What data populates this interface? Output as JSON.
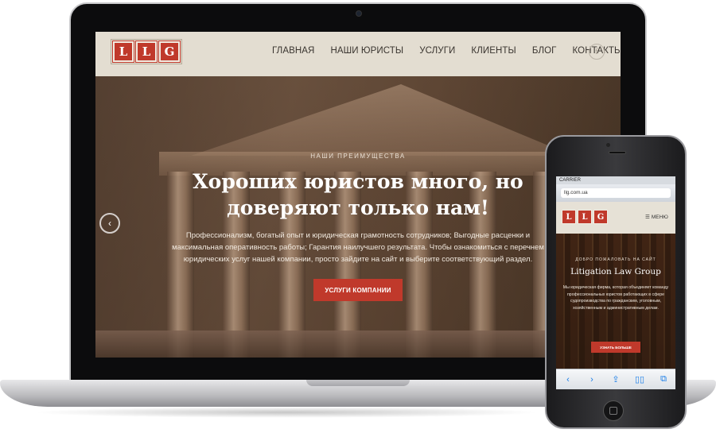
{
  "desktop": {
    "logo_letters": [
      "L",
      "L",
      "G"
    ],
    "nav": [
      "ГЛАВНАЯ",
      "НАШИ ЮРИСТЫ",
      "УСЛУГИ",
      "КЛИЕНТЫ",
      "БЛОГ",
      "КОНТАКТЫ"
    ],
    "facebook_glyph": "f",
    "hero": {
      "eyebrow": "НАШИ ПРЕИМУЩЕСТВА",
      "title": "Хороших юристов много, но доверяют только нам!",
      "text": "Профессионализм, богатый опыт и юридическая грамотность сотрудников; Выгодные расценки и максимальная оперативность работы; Гарантия наилучшего результата. Чтобы ознакомиться с перечнем юридических услуг нашей компании, просто зайдите на сайт и выберите соответствующий раздел.",
      "button": "УСЛУГИ КОМПАНИИ",
      "prev_glyph": "‹"
    }
  },
  "mobile": {
    "status": "CARRIER",
    "url": "llg.com.ua",
    "logo_letters": [
      "L",
      "L",
      "G"
    ],
    "menu_label": "МЕНЮ",
    "menu_glyph": "☰",
    "hero": {
      "eyebrow": "ДОБРО ПОЖАЛОВАТЬ НА САЙТ",
      "title": "Litigation Law Group",
      "text": "Мы юридическая фирма, которая объединяет команду профессиональных юристов работающих в сфере судопроизводства по гражданским, уголовным, хозяйственным и административным делам.",
      "button": "УЗНАТЬ БОЛЬШЕ"
    },
    "toolbar": [
      "‹",
      "›",
      "⇪",
      "▯▯",
      "⧉"
    ]
  },
  "colors": {
    "accent": "#c0392b",
    "header_bg": "#e3ddd1"
  }
}
